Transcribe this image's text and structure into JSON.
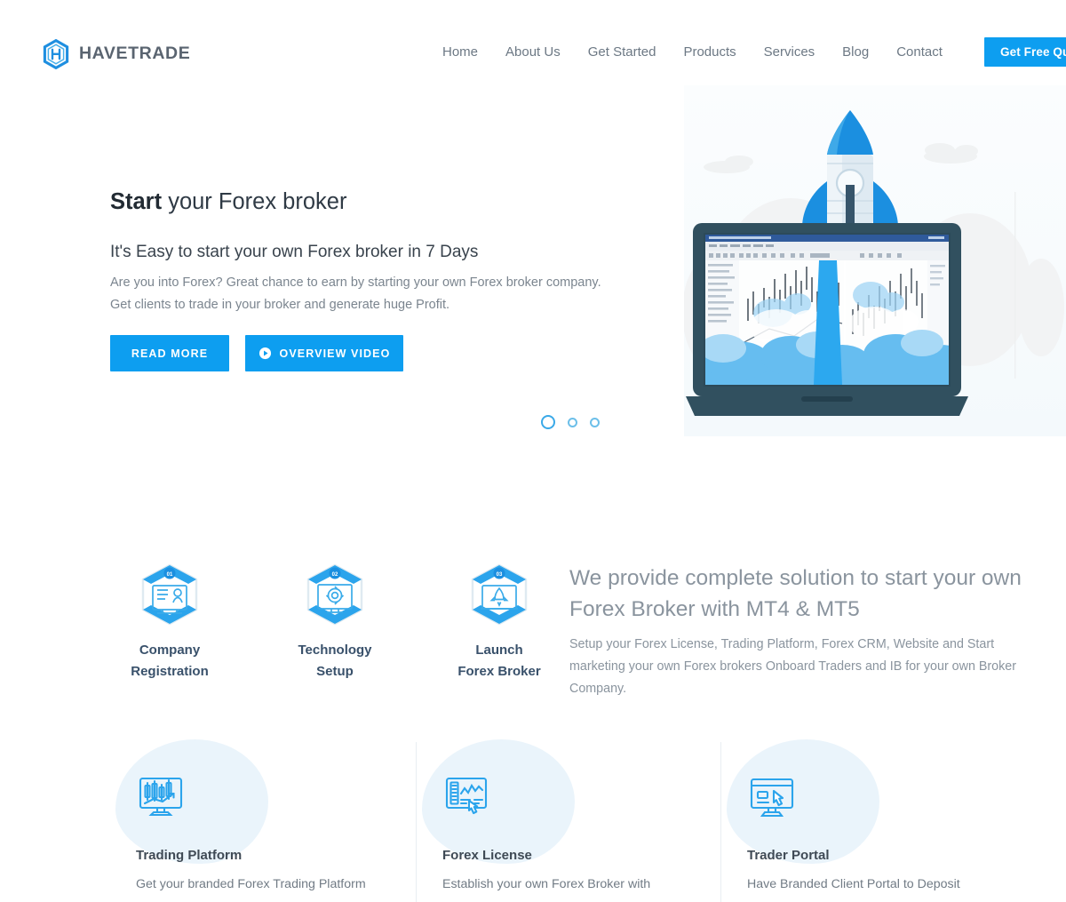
{
  "brand": {
    "name": "HAVETRADE",
    "logo_icon": "hexagon-h-logo-icon",
    "accent_color": "#0d9ef0",
    "logo_text_color": "#5a6470"
  },
  "header": {
    "nav": [
      {
        "label": "Home",
        "name": "nav-item-home"
      },
      {
        "label": "About Us",
        "name": "nav-item-about-us"
      },
      {
        "label": "Get Started",
        "name": "nav-item-get-started"
      },
      {
        "label": "Products",
        "name": "nav-item-products"
      },
      {
        "label": "Services",
        "name": "nav-item-services"
      },
      {
        "label": "Blog",
        "name": "nav-item-blog"
      },
      {
        "label": "Contact",
        "name": "nav-item-contact"
      }
    ],
    "cta": {
      "label": "Get Free Quote",
      "color": "#0d9ef0"
    }
  },
  "hero": {
    "title_bold": "Start",
    "title_rest": " your Forex broker",
    "subtitle": "It's Easy to start your own Forex broker in 7 Days",
    "description_line1": "Are you into Forex? Great chance to earn by starting your own Forex broker company.",
    "description_line2": "Get clients to trade in your broker and generate huge Profit.",
    "buttons": {
      "read_more": "READ MORE",
      "overview_video": "OVERVIEW VIDEO",
      "play_icon": "play-circle-icon"
    },
    "carousel": {
      "total_slides": 3,
      "active_slide": 1
    },
    "illustration": "rocket-launching-from-laptop-with-forex-charts"
  },
  "steps": [
    {
      "number": "01",
      "line1": "Company",
      "line2": "Registration",
      "icon": "company-registration-icon",
      "name": "step-company-registration"
    },
    {
      "number": "02",
      "line1": "Technology",
      "line2": "Setup",
      "icon": "technology-setup-icon",
      "name": "step-technology-setup"
    },
    {
      "number": "03",
      "line1": "Launch",
      "line2": "Forex Broker",
      "icon": "launch-forex-broker-icon",
      "name": "step-launch-forex-broker"
    }
  ],
  "solution": {
    "title_line1": "We provide complete solution to start your",
    "title_line2": "own Forex Broker with MT4 & MT5",
    "description": "Setup your Forex License, Trading Platform, Forex CRM, Website and Start marketing your own Forex brokers Onboard Traders and IB for your own Broker Company."
  },
  "cards": [
    {
      "title": "Trading Platform",
      "description": "Get your branded Forex Trading Platform",
      "icon": "trading-chart-monitor-icon",
      "name": "card-trading-platform"
    },
    {
      "title": "Forex License",
      "description": "Establish your own Forex Broker with",
      "icon": "license-chart-click-icon",
      "name": "card-forex-license"
    },
    {
      "title": "Trader Portal",
      "description": "Have Branded Client Portal to Deposit",
      "icon": "trader-portal-monitor-icon",
      "name": "card-trader-portal"
    }
  ]
}
